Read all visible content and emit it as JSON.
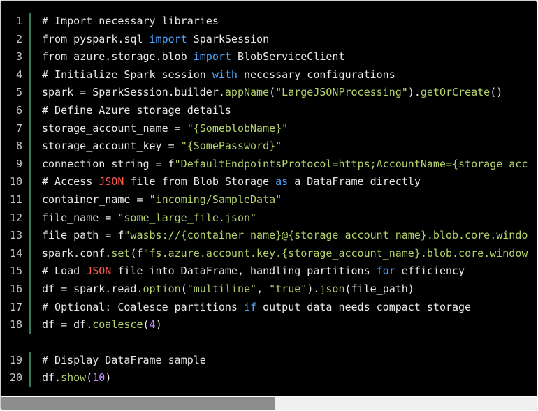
{
  "editor": {
    "language": "python",
    "block1": {
      "lines": [
        {
          "n": "1",
          "tokens": [
            [
              "c",
              "# Import necessary libraries"
            ]
          ]
        },
        {
          "n": "2",
          "tokens": [
            [
              "p",
              "from pyspark.sql "
            ],
            [
              "k",
              "import"
            ],
            [
              "p",
              " SparkSession"
            ]
          ]
        },
        {
          "n": "3",
          "tokens": [
            [
              "p",
              "from azure.storage.blob "
            ],
            [
              "k",
              "import"
            ],
            [
              "p",
              " BlobServiceClient"
            ]
          ]
        },
        {
          "n": "4",
          "tokens": [
            [
              "c",
              "# Initialize Spark session "
            ],
            [
              "k",
              "with"
            ],
            [
              "c",
              " necessary configurations"
            ]
          ]
        },
        {
          "n": "5",
          "tokens": [
            [
              "p",
              "spark = SparkSession.builder."
            ],
            [
              "f",
              "appName"
            ],
            [
              "p",
              "("
            ],
            [
              "s",
              "\"LargeJSONProcessing\""
            ],
            [
              "p",
              ")."
            ],
            [
              "f",
              "getOrCreate"
            ],
            [
              "p",
              "()"
            ]
          ]
        },
        {
          "n": "6",
          "tokens": [
            [
              "c",
              "# Define Azure storage details"
            ]
          ]
        },
        {
          "n": "7",
          "tokens": [
            [
              "p",
              "storage_account_name = "
            ],
            [
              "s",
              "\"{SomeblobName}\""
            ]
          ]
        },
        {
          "n": "8",
          "tokens": [
            [
              "p",
              "storage_account_key = "
            ],
            [
              "s",
              "\"{SomePassword}\""
            ]
          ]
        },
        {
          "n": "9",
          "tokens": [
            [
              "p",
              "connection_string = f"
            ],
            [
              "s",
              "\"DefaultEndpointsProtocol=https;AccountName={storage_acc"
            ]
          ]
        },
        {
          "n": "10",
          "tokens": [
            [
              "c",
              "# Access "
            ],
            [
              "r",
              "JSON"
            ],
            [
              "c",
              " file from Blob Storage "
            ],
            [
              "k",
              "as"
            ],
            [
              "c",
              " a DataFrame directly"
            ]
          ]
        },
        {
          "n": "11",
          "tokens": [
            [
              "p",
              "container_name = "
            ],
            [
              "s",
              "\"incoming/SampleData\""
            ]
          ]
        },
        {
          "n": "12",
          "tokens": [
            [
              "p",
              "file_name = "
            ],
            [
              "s",
              "\"some_large_file.json\""
            ]
          ]
        },
        {
          "n": "13",
          "tokens": [
            [
              "p",
              "file_path = f"
            ],
            [
              "s",
              "\"wasbs://{container_name}@{storage_account_name}.blob.core.windo"
            ]
          ]
        },
        {
          "n": "14",
          "tokens": [
            [
              "p",
              "spark.conf."
            ],
            [
              "f",
              "set"
            ],
            [
              "p",
              "(f"
            ],
            [
              "s",
              "\"fs.azure.account.key.{storage_account_name}.blob.core.window"
            ]
          ]
        },
        {
          "n": "15",
          "tokens": [
            [
              "c",
              "# Load "
            ],
            [
              "r",
              "JSON"
            ],
            [
              "c",
              " file into DataFrame, handling partitions "
            ],
            [
              "k",
              "for"
            ],
            [
              "c",
              " efficiency"
            ]
          ]
        },
        {
          "n": "16",
          "tokens": [
            [
              "p",
              "df = spark.read."
            ],
            [
              "f",
              "option"
            ],
            [
              "p",
              "("
            ],
            [
              "s",
              "\"multiline\""
            ],
            [
              "p",
              ", "
            ],
            [
              "s",
              "\"true\""
            ],
            [
              "p",
              ")."
            ],
            [
              "f",
              "json"
            ],
            [
              "p",
              "(file_path)"
            ]
          ]
        },
        {
          "n": "17",
          "tokens": [
            [
              "c",
              "# Optional: Coalesce partitions "
            ],
            [
              "k",
              "if"
            ],
            [
              "c",
              " output data needs compact storage"
            ]
          ]
        },
        {
          "n": "18",
          "tokens": [
            [
              "p",
              "df = df."
            ],
            [
              "f",
              "coalesce"
            ],
            [
              "p",
              "("
            ],
            [
              "n",
              "4"
            ],
            [
              "p",
              ")"
            ]
          ]
        }
      ]
    },
    "block2": {
      "lines": [
        {
          "n": "19",
          "tokens": [
            [
              "c",
              "# Display DataFrame sample"
            ]
          ]
        },
        {
          "n": "20",
          "tokens": [
            [
              "p",
              "df."
            ],
            [
              "f",
              "show"
            ],
            [
              "p",
              "("
            ],
            [
              "n",
              "10"
            ],
            [
              "p",
              ")"
            ]
          ]
        }
      ]
    },
    "scrollbar": {
      "horizontal_position_fraction": 0.0,
      "thumb_fraction": 0.51
    }
  }
}
